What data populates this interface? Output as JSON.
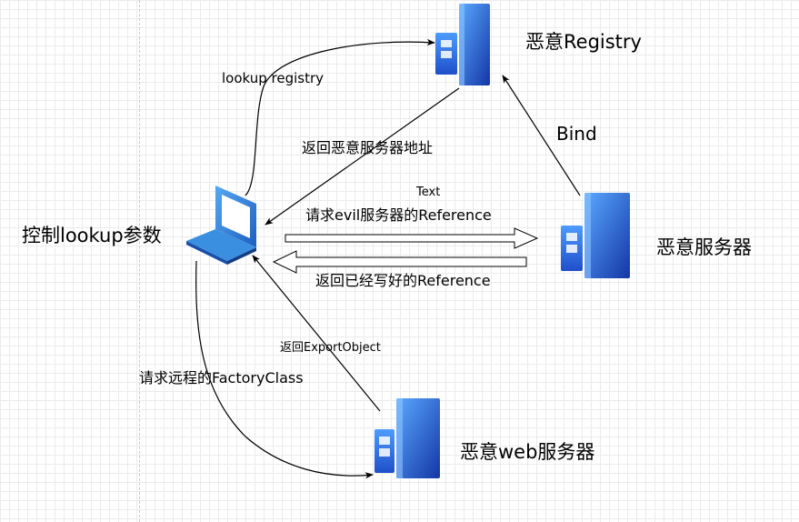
{
  "nodes": {
    "registry": {
      "label": "恶意Registry",
      "icon": "server-icon"
    },
    "evil_server": {
      "label": "恶意服务器",
      "icon": "server-icon"
    },
    "web_server": {
      "label": "恶意web服务器",
      "icon": "server-icon"
    },
    "client": {
      "label": "控制lookup参数",
      "icon": "laptop-icon"
    }
  },
  "edges": {
    "lookup_registry": "lookup registry",
    "return_address": "返回恶意服务器地址",
    "bind": "Bind",
    "text": "Text",
    "request_reference": "请求evil服务器的Reference",
    "return_reference": "返回已经写好的Reference",
    "return_export_object": "返回ExportObject",
    "request_factory_class": "请求远程的FactoryClass"
  },
  "colors": {
    "server_dark": "#1a3fb8",
    "server_light": "#3f8fff",
    "laptop": "#2a7fd8",
    "line": "#000000"
  }
}
